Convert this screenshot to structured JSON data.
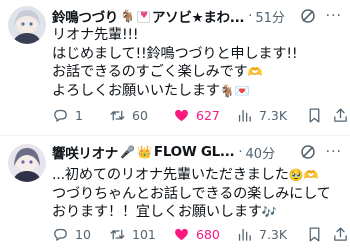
{
  "tweets": [
    {
      "name": "鈴鳴つづり",
      "name_rest": "アソビ★まわ...",
      "name_emojis": [
        "🐐"
      ],
      "time": "51分",
      "lines": [
        "リオナ先輩!!!",
        "はじめまして!!鈴鳴つづりと申します!!",
        "お話できるのすごく楽しみです",
        "よろしくお願いいたします"
      ],
      "line_emojis": [
        "🫶",
        "🐐💌"
      ],
      "reply_count": "1",
      "retweet_count": "60",
      "like_count": "627",
      "view_count": "7.3K"
    },
    {
      "name": "響咲リオナ",
      "name_rest": "FLOW GL...",
      "name_emojis": [
        "🎤",
        "👑"
      ],
      "time": "40分",
      "lines": [
        "...初めてのリオナ先輩いただきました",
        "つづりちゃんとお話しできるの楽しみにして",
        "おります！！宜しくお願いします"
      ],
      "line_emojis": [
        "🥹🫶",
        "🎶"
      ],
      "reply_count": "10",
      "retweet_count": "101",
      "like_count": "680",
      "view_count": "7.3K"
    }
  ],
  "icons": [
    "avatar",
    "goat-emoji",
    "heart-letter-emoji",
    "grok-icon",
    "more-icon",
    "reply-icon",
    "retweet-icon",
    "like-icon",
    "views-icon",
    "bookmark-icon",
    "share-icon"
  ],
  "colors": {
    "text": "#0f1419",
    "muted": "#536471",
    "like": "#f91880",
    "separator": "#eff3f4"
  }
}
